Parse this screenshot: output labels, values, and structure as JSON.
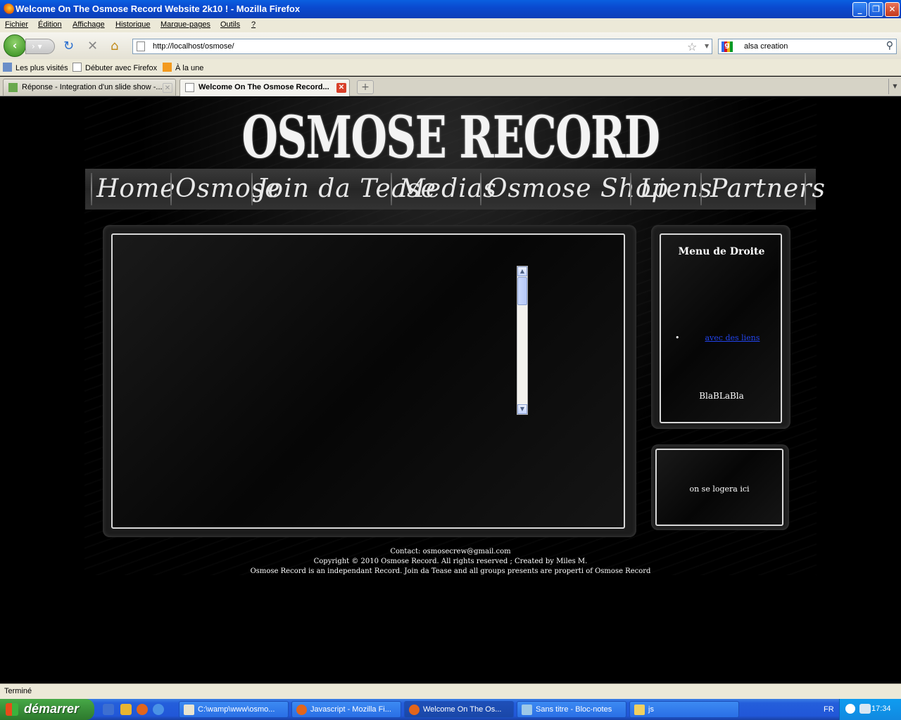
{
  "window": {
    "title": "Welcome On The Osmose Record Website 2k10 ! - Mozilla Firefox",
    "minimize": "_",
    "restore": "❐",
    "close": "✕"
  },
  "menu": [
    "Fichier",
    "Édition",
    "Affichage",
    "Historique",
    "Marque-pages",
    "Outils",
    "?"
  ],
  "toolbar": {
    "url": "http://localhost/osmose/",
    "search_value": "alsa creation"
  },
  "bookmarks": [
    "Les plus visités",
    "Débuter avec Firefox",
    "À la une"
  ],
  "tabs": [
    {
      "label": "Réponse - Integration d'un slide show -..."
    },
    {
      "label": "Welcome On The Osmose Record..."
    }
  ],
  "page": {
    "logo": "OSMOSE RECORD",
    "nav": [
      "Home",
      "Osmose",
      "Join da Tease",
      "Medias",
      "Osmose Shop",
      "Liens",
      "Partners"
    ],
    "right_menu_title": "Menu de Droite",
    "right_menu_link": "avec des liens",
    "right_menu_text": "BlaBLaBla",
    "login_text": "on se logera ici",
    "footer": [
      "Contact: osmosecrew@gmail.com",
      "Copyright © 2010 Osmose Record. All rights reserved ; Created by Miles M.",
      "Osmose Record is an independant Record. Join da Tease and all groups presents are properti of Osmose Record"
    ]
  },
  "status": "Terminé",
  "taskbar": {
    "start": "démarrer",
    "tasks": [
      {
        "label": "C:\\wamp\\www\\osmo..."
      },
      {
        "label": "Javascript - Mozilla Fi..."
      },
      {
        "label": "Welcome On The Os..."
      },
      {
        "label": "Sans titre - Bloc-notes"
      },
      {
        "label": "js"
      }
    ],
    "lang": "FR",
    "clock": "17:34"
  },
  "colors": {
    "titlebar": "#0a4ad0",
    "page_bg": "#000000",
    "link": "#2244ee",
    "start_green": "#3c943c"
  }
}
